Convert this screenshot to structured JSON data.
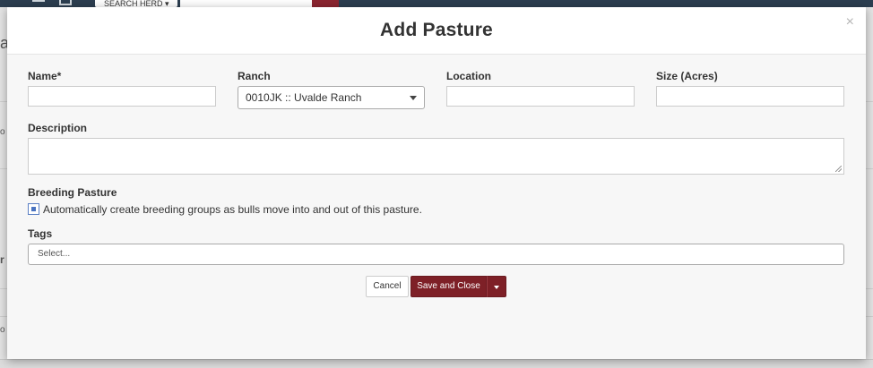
{
  "background": {
    "search_label": "SEARCH HERD",
    "left_glyphs": [
      "a",
      "o",
      "r",
      "o"
    ]
  },
  "modal": {
    "title": "Add Pasture",
    "close_symbol": "×",
    "fields": {
      "name": {
        "label": "Name*",
        "value": ""
      },
      "ranch": {
        "label": "Ranch",
        "selected": "0010JK :: Uvalde Ranch"
      },
      "location": {
        "label": "Location",
        "value": ""
      },
      "size": {
        "label": "Size (Acres)",
        "value": ""
      },
      "description": {
        "label": "Description",
        "value": ""
      },
      "breeding": {
        "label": "Breeding Pasture",
        "checkbox_text": "Automatically create breeding groups as bulls move into and out of this pasture.",
        "checked": true
      },
      "tags": {
        "label": "Tags",
        "placeholder": "Select..."
      }
    },
    "buttons": {
      "cancel": "Cancel",
      "save": "Save and Close"
    },
    "colors": {
      "primary": "#7e2027",
      "checkbox_accent": "#4a73c0",
      "topbar": "#2c3e50"
    }
  }
}
